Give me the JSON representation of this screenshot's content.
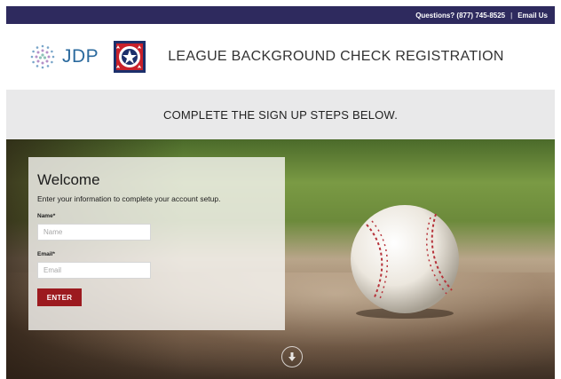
{
  "topbar": {
    "questions_text": "Questions? (877) 745-8525",
    "separator": "|",
    "email_link": "Email Us"
  },
  "header": {
    "jdp_logo_text": "JDP",
    "title": "LEAGUE BACKGROUND CHECK REGISTRATION"
  },
  "band": {
    "text": "COMPLETE THE SIGN UP STEPS BELOW."
  },
  "form": {
    "heading": "Welcome",
    "subtitle": "Enter your information to complete your account setup.",
    "name_label": "Name*",
    "name_placeholder": "Name",
    "name_value": "",
    "email_label": "Email*",
    "email_placeholder": "Email",
    "email_value": "",
    "enter_label": "ENTER"
  },
  "icons": {
    "jdp_logo": "dotted-circle-logo",
    "league_logo": "star-shield-badge",
    "baseball": "baseball-image",
    "scroll_down": "arrow-down-circle-icon"
  },
  "colors": {
    "topbar": "#2e2a5e",
    "jdp_blue": "#2b6a9e",
    "band": "#e9e9ea",
    "enter_button": "#9c1a1f"
  }
}
